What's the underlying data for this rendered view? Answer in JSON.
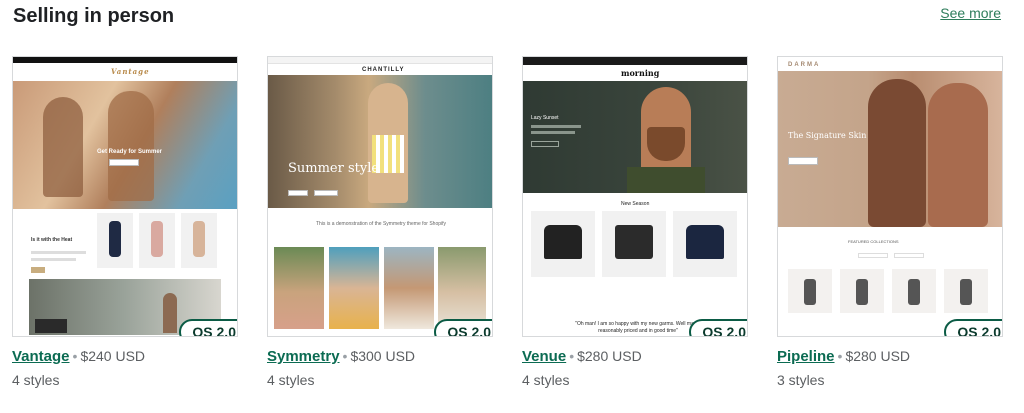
{
  "section": {
    "title": "Selling in person",
    "see_more": "See more"
  },
  "badge_label": "OS 2.0",
  "themes": [
    {
      "name": "Vantage",
      "price": "$240 USD",
      "styles": "4 styles",
      "preview": {
        "logo": "Vantage",
        "hero_text": "Get Ready for Summer",
        "side_title": "Is it with the Heat",
        "colors": {
          "hero": "#c99a78",
          "accent": "#c8ad7f",
          "sea": "#5aa0c2"
        }
      }
    },
    {
      "name": "Symmetry",
      "price": "$300 USD",
      "styles": "4 styles",
      "preview": {
        "logo": "CHANTILLY",
        "hero_text": "Summer style",
        "caption": "This is a demonstration of the Symmetry theme for Shopify",
        "colors": {
          "hero": "#9b8566"
        }
      }
    },
    {
      "name": "Venue",
      "price": "$280 USD",
      "styles": "4 styles",
      "preview": {
        "logo": "morning",
        "hero_text": "Lazy Sunset",
        "section_title": "New Season",
        "quote": "\"Oh man! I am so happy with my new garms. Well made, reasonably priced and in good time\"",
        "colors": {
          "hero": "#3a453c",
          "shirt_dark": "#222222",
          "shirt_navy": "#1b2640"
        }
      }
    },
    {
      "name": "Pipeline",
      "price": "$280 USD",
      "styles": "3 styles",
      "preview": {
        "logo": "DARMA",
        "hero_text": "The Signature Skin",
        "section_title": "FEATURED COLLECTIONS",
        "colors": {
          "hero": "#c4a48a",
          "skin": "#a86b4e"
        }
      }
    }
  ]
}
